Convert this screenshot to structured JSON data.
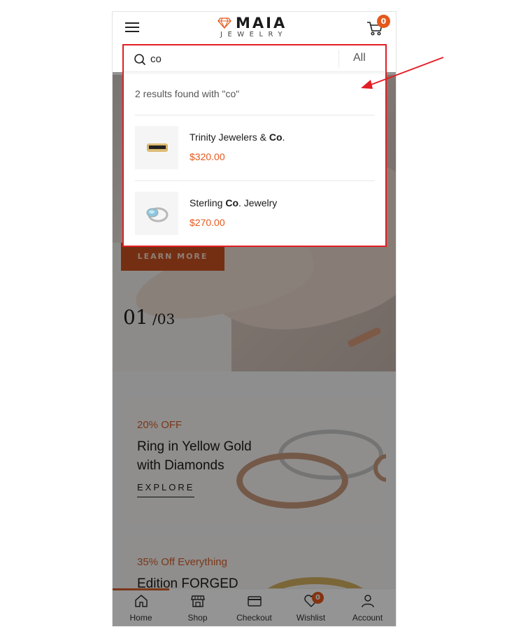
{
  "header": {
    "logo_main": "MAIA",
    "logo_sub": "JEWELRY",
    "cart_count": "0"
  },
  "search": {
    "query": "co",
    "category": "All",
    "result_count_text": "2 results found with \"co\"",
    "results": [
      {
        "name_before": "Trinity Jewelers & ",
        "name_match": "Co",
        "name_after": ".",
        "price": "$320.00"
      },
      {
        "name_before": "Sterling ",
        "name_match": "Co",
        "name_after": ". Jewelry",
        "price": "$270.00"
      }
    ]
  },
  "hero": {
    "button_label": "LEARN MORE",
    "slide_current": "01",
    "slide_total": " /03"
  },
  "promos": [
    {
      "discount": "20% OFF",
      "title": "Ring in Yellow Gold with Diamonds",
      "link": "EXPLORE"
    },
    {
      "discount": "35% Off Everything",
      "title": "Edition FORGED"
    }
  ],
  "bottom_nav": {
    "items": [
      {
        "label": "Home",
        "icon": "home-icon"
      },
      {
        "label": "Shop",
        "icon": "shop-icon"
      },
      {
        "label": "Checkout",
        "icon": "card-icon"
      },
      {
        "label": "Wishlist",
        "icon": "heart-icon"
      },
      {
        "label": "Account",
        "icon": "user-icon"
      }
    ],
    "wishlist_count": "0"
  },
  "colors": {
    "accent": "#e4581d",
    "highlight_border": "#e41e25"
  }
}
